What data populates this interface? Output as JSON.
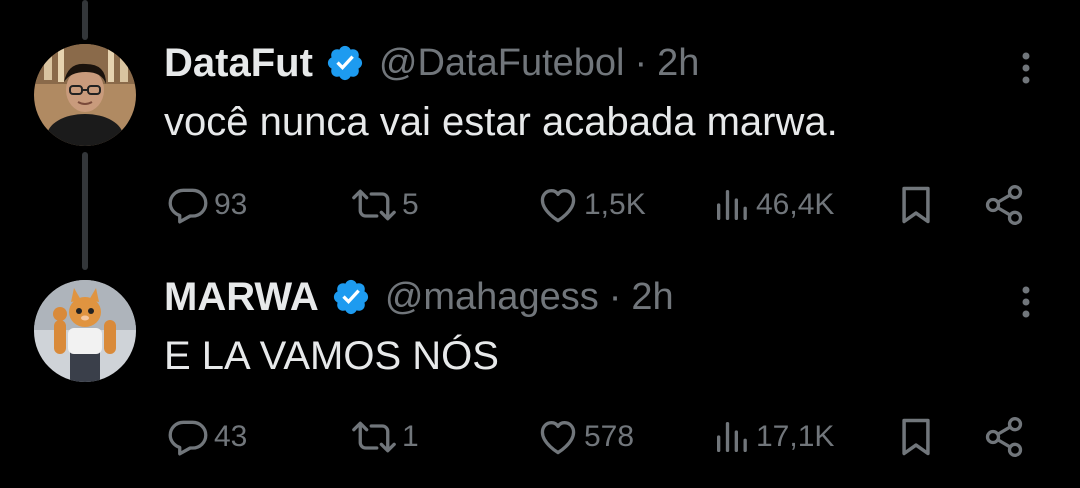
{
  "colors": {
    "background": "#000000",
    "primary_text": "#e7e9ea",
    "secondary_text": "#71767b",
    "verified_badge": "#1d9bf0",
    "thread_line": "#333639"
  },
  "tweets": [
    {
      "author_name": "DataFut",
      "handle": "@DataFutebol",
      "separator": "·",
      "time": "2h",
      "text": "você nunca vai estar acabada marwa.",
      "avatar_icon": "profile-photo-man-glasses",
      "verified": true,
      "stats": {
        "replies": "93",
        "retweets": "5",
        "likes": "1,5K",
        "views": "46,4K"
      }
    },
    {
      "author_name": "MARWA",
      "handle": "@mahagess",
      "separator": "·",
      "time": "2h",
      "text": "E LA VAMOS NÓS",
      "avatar_icon": "profile-photo-muscular-cat",
      "verified": true,
      "stats": {
        "replies": "43",
        "retweets": "1",
        "likes": "578",
        "views": "17,1K"
      }
    }
  ]
}
